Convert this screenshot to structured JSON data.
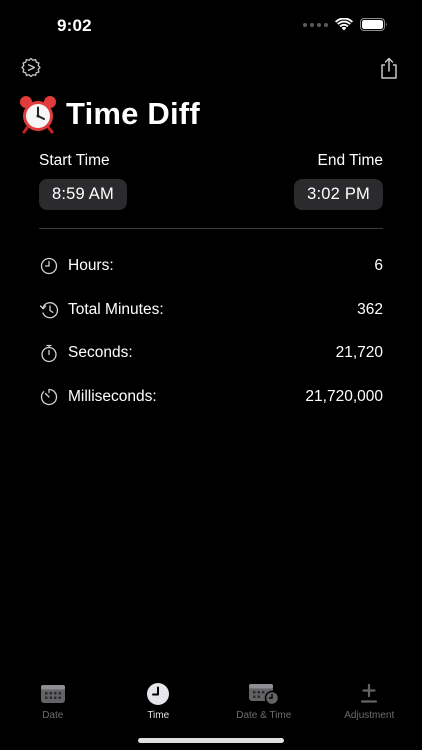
{
  "status_bar": {
    "time": "9:02"
  },
  "header": {
    "title": "Time Diff",
    "settings_icon": "gear-icon",
    "share_icon": "share-icon"
  },
  "pickers": {
    "start_label": "Start Time",
    "start_value": "8:59 AM",
    "end_label": "End Time",
    "end_value": "3:02 PM"
  },
  "results": [
    {
      "icon": "clock-icon",
      "label": "Hours:",
      "value": "6"
    },
    {
      "icon": "history-icon",
      "label": "Total Minutes:",
      "value": "362"
    },
    {
      "icon": "stopwatch-icon",
      "label": "Seconds:",
      "value": "21,720"
    },
    {
      "icon": "timer-icon",
      "label": "Milliseconds:",
      "value": "21,720,000"
    }
  ],
  "tabs": [
    {
      "label": "Date",
      "icon": "calendar-icon",
      "active": false
    },
    {
      "label": "Time",
      "icon": "clock-icon",
      "active": true
    },
    {
      "label": "Date & Time",
      "icon": "calendar-clock-icon",
      "active": false
    },
    {
      "label": "Adjustment",
      "icon": "plus-minus-icon",
      "active": false
    }
  ],
  "colors": {
    "background": "#000000",
    "pill": "#2b2b2e",
    "divider": "#3a3a3c",
    "tab_inactive": "#6c6c70",
    "tab_active": "#e5e5ea"
  }
}
